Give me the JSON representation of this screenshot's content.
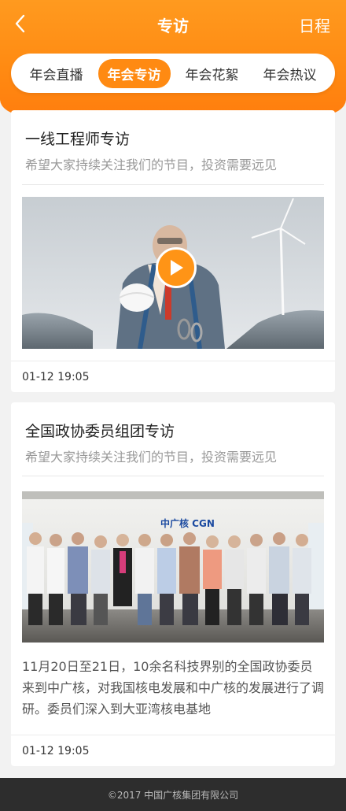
{
  "header": {
    "title": "专访",
    "right_action": "日程",
    "back_icon": "chevron-left-icon"
  },
  "tabs": [
    {
      "label": "年会直播",
      "active": false
    },
    {
      "label": "年会专访",
      "active": true
    },
    {
      "label": "年会花絮",
      "active": false
    },
    {
      "label": "年会热议",
      "active": false
    }
  ],
  "cards": [
    {
      "title": "一线工程师专访",
      "subtitle": "希望大家持续关注我们的节目，投资需要远见",
      "media": "video",
      "time": "01-12 19:05"
    },
    {
      "title": "全国政协委员组团专访",
      "subtitle": "希望大家持续关注我们的节目，投资需要远见",
      "media": "photo",
      "photo_sign": "中广核 CGN",
      "description": "11月20日至21日，10余名科技界别的全国政协委员来到中广核，对我国核电发展和中广核的发展进行了调研。委员们深入到大亚湾核电基地",
      "time": "01-12 19:05"
    }
  ],
  "footer": {
    "copyright": "©2017 中国广核集团有限公司"
  },
  "colors": {
    "accent": "#ff8a12",
    "background": "#f2f2f2",
    "footer_bg": "#2d2d2d"
  }
}
